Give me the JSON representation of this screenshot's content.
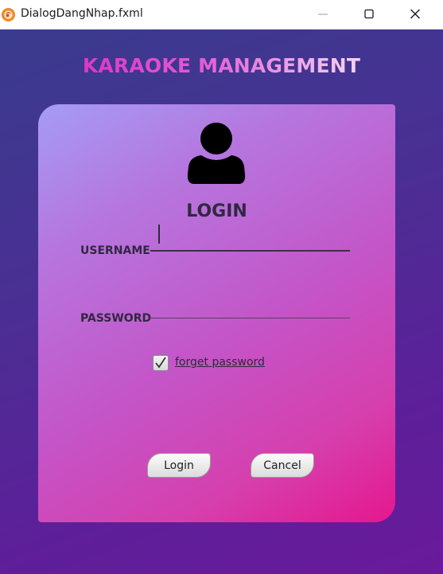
{
  "window": {
    "title": "DialogDangNhap.fxml",
    "icons": [
      "app-icon",
      "minimize-icon",
      "maximize-icon",
      "close-icon"
    ]
  },
  "header": {
    "app_title": "KARAOKE MANAGEMENT"
  },
  "card": {
    "title": "LOGIN",
    "user_icon": "user-icon",
    "username": {
      "label": "USERNAME",
      "value": ""
    },
    "password": {
      "label": "PASSWORD",
      "value": ""
    },
    "remember": {
      "label": "forget password",
      "checked": true
    },
    "buttons": {
      "login": "Login",
      "cancel": "Cancel"
    }
  },
  "colors": {
    "background": "#4a2f93",
    "card_gradient_start": "#a59cf5",
    "card_gradient_end": "#e5178e",
    "heading_accent": "#d81fb3",
    "text_dark": "#2f2840"
  }
}
